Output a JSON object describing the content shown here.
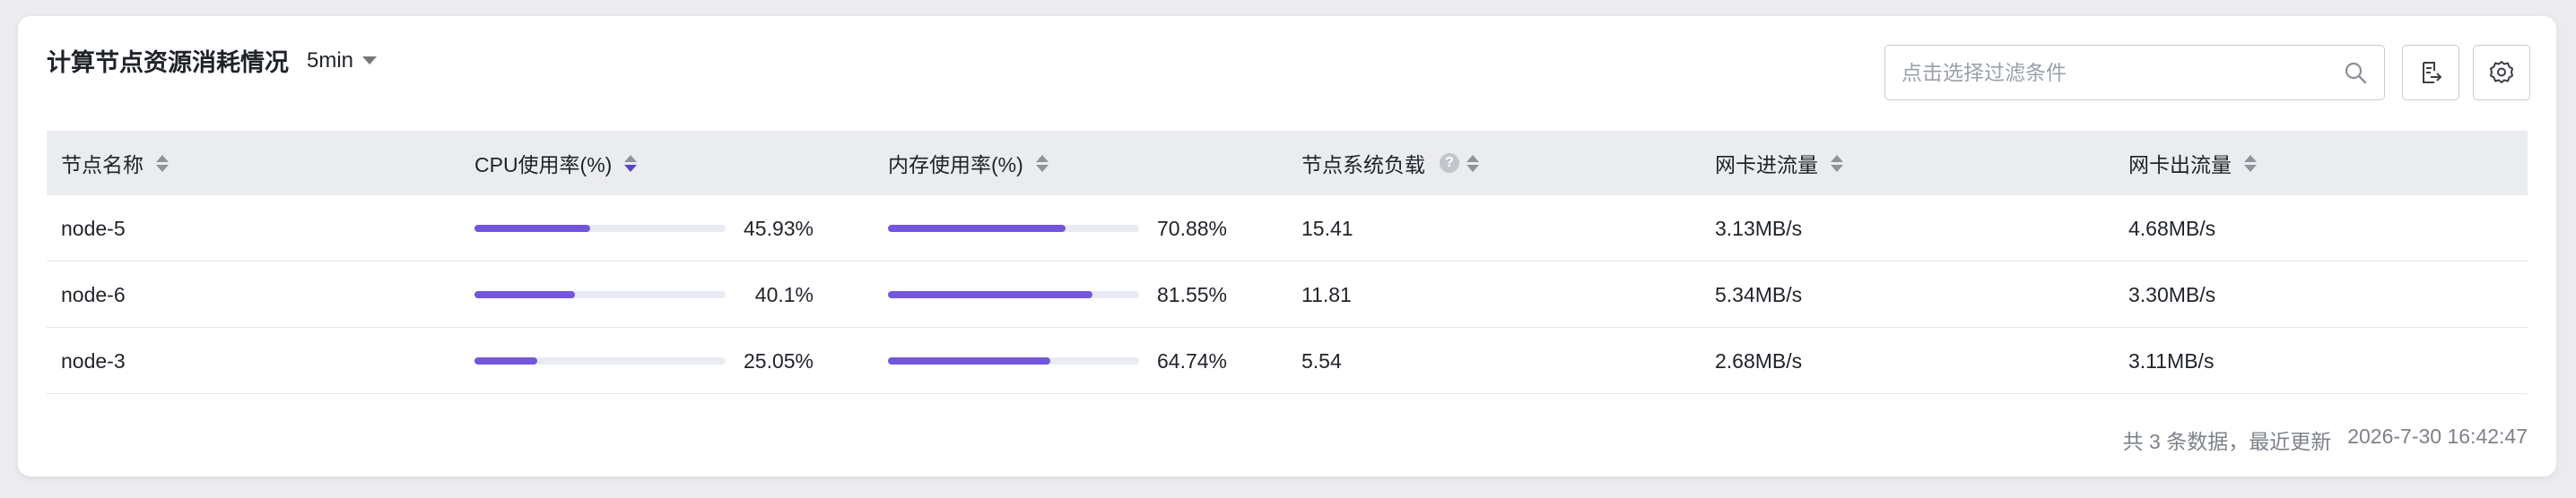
{
  "header": {
    "title": "计算节点资源消耗情况",
    "interval": "5min"
  },
  "search": {
    "placeholder": "点击选择过滤条件"
  },
  "columns": [
    {
      "label": "节点名称",
      "sort": "none"
    },
    {
      "label": "CPU使用率(%)",
      "sort": "desc"
    },
    {
      "label": "内存使用率(%)",
      "sort": "none"
    },
    {
      "label": "节点系统负载",
      "sort": "none",
      "help": "?"
    },
    {
      "label": "网卡进流量",
      "sort": "none"
    },
    {
      "label": "网卡出流量",
      "sort": "none"
    }
  ],
  "rows": [
    {
      "name": "node-5",
      "cpu": 45.93,
      "cpu_label": "45.93%",
      "mem": 70.88,
      "mem_label": "70.88%",
      "load": "15.41",
      "net_in": "3.13MB/s",
      "net_out": "4.68MB/s"
    },
    {
      "name": "node-6",
      "cpu": 40.1,
      "cpu_label": "40.1%",
      "mem": 81.55,
      "mem_label": "81.55%",
      "load": "11.81",
      "net_in": "5.34MB/s",
      "net_out": "3.30MB/s"
    },
    {
      "name": "node-3",
      "cpu": 25.05,
      "cpu_label": "25.05%",
      "mem": 64.74,
      "mem_label": "64.74%",
      "load": "5.54",
      "net_in": "2.68MB/s",
      "net_out": "3.11MB/s"
    }
  ],
  "footer": {
    "count_text": "共 3 条数据，最近更新",
    "updated": "2026-7-30 16:42:47"
  },
  "colors": {
    "accent": "#7356dd",
    "track": "#e8ebf3",
    "header_bg": "#ebecf0"
  },
  "icons": {
    "interval": "chevron-down-icon",
    "search": "search-icon",
    "export": "export-icon",
    "settings": "gear-icon",
    "help": "help-icon"
  }
}
